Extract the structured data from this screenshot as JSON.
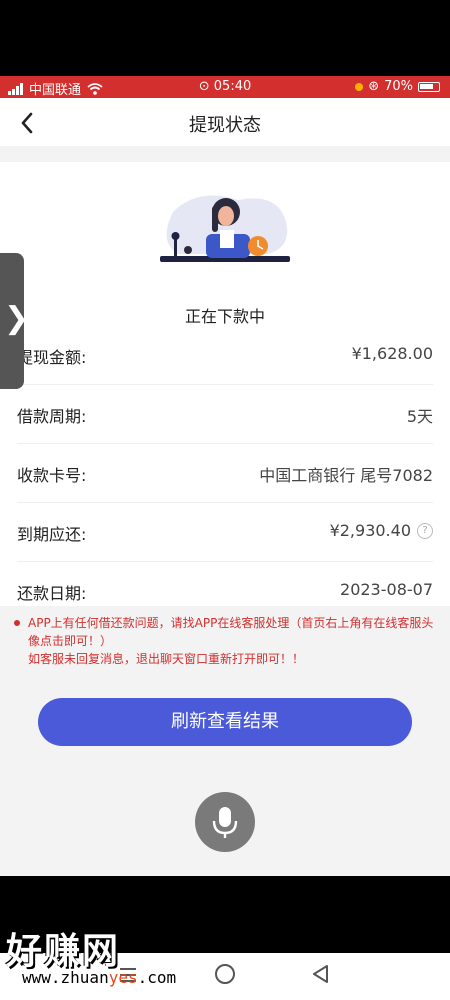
{
  "status_bar": {
    "carrier": "中国联通",
    "time": "05:40",
    "battery": "70%"
  },
  "header": {
    "back_icon": "chevron-left-icon",
    "title": "提现状态"
  },
  "status": {
    "text": "正在下款中"
  },
  "details": [
    {
      "label": "提现金额:",
      "value": "¥1,628.00"
    },
    {
      "label": "借款周期:",
      "value": "5天"
    },
    {
      "label": "收款卡号:",
      "value": "中国工商银行 尾号7082"
    },
    {
      "label": "到期应还:",
      "value": "¥2,930.40"
    },
    {
      "label": "还款日期:",
      "value": "2023-08-07"
    }
  ],
  "notice": {
    "line1": "APP上有任何借还款问题，请找APP在线客服处理（首页右上角有在线客服头像点击即可！）",
    "line2": "如客服未回复消息，退出聊天窗口重新打开即可！！"
  },
  "refresh_button": {
    "label": "刷新查看结果"
  },
  "watermark": {
    "text": "好赚网",
    "url_prefix": "www.zhuan",
    "url_highlight": "yes",
    "url_suffix": ".com"
  },
  "colors": {
    "status_bar": "#d32f2f",
    "accent": "#4a5ad9",
    "notice": "#d32f2f"
  }
}
